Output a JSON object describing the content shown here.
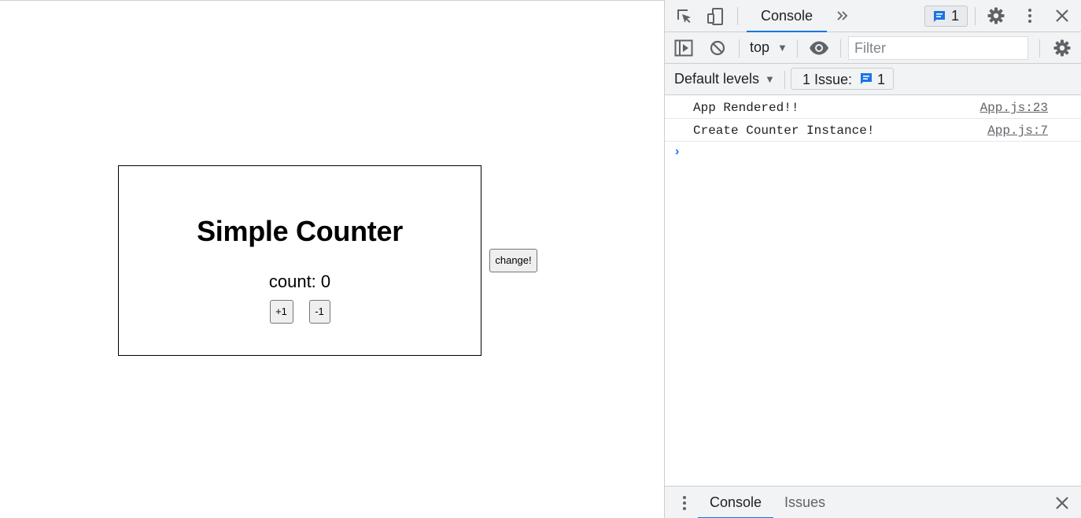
{
  "app": {
    "title": "Simple Counter",
    "count_text": "count: 0",
    "increment_label": "+1",
    "decrement_label": "-1",
    "change_label": "change!"
  },
  "devtools": {
    "toolbar": {
      "tab_console": "Console",
      "issue_count": "1"
    },
    "console_bar": {
      "context": "top",
      "filter_placeholder": "Filter"
    },
    "levels_bar": {
      "levels": "Default levels",
      "issues_label": "1 Issue:",
      "issues_count": "1"
    },
    "messages": [
      {
        "text": "App Rendered!!",
        "source": "App.js:23"
      },
      {
        "text": "Create Counter Instance!",
        "source": "App.js:7"
      }
    ],
    "prompt": "›",
    "drawer": {
      "tab_console": "Console",
      "tab_issues": "Issues"
    }
  },
  "colors": {
    "accent": "#1a73e8",
    "toolbar_bg": "#f1f3f4",
    "icon_gray": "#5f6368"
  },
  "icons": [
    "inspect-element-icon",
    "device-toolbar-icon",
    "more-tabs-icon",
    "issue-message-icon",
    "settings-gear-icon",
    "kebab-menu-icon",
    "close-icon",
    "sidebar-toggle-icon",
    "clear-console-icon",
    "live-expression-eye-icon",
    "dropdown-triangle-icon",
    "prompt-chevron-icon"
  ]
}
